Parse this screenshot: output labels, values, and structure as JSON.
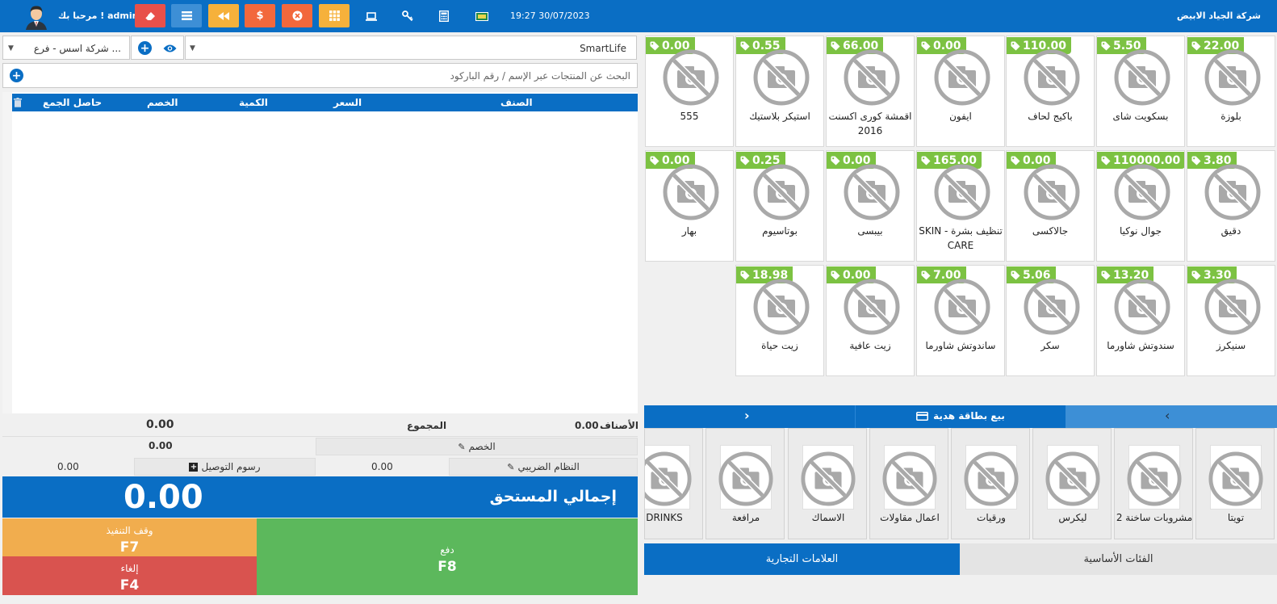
{
  "header": {
    "welcome": "مرحبا بك ! admin",
    "datetime": "19:27 30/07/2023",
    "company": "شركة الجياد الابيض",
    "colors": {
      "bar": "#0a6ec4",
      "red": "#e8504a",
      "blue": "#3d8fd6",
      "orange": "#f6b13b",
      "gift": "#1f8a4c"
    },
    "buttons": [
      {
        "name": "eraser-icon",
        "color": "#e8504a"
      },
      {
        "name": "list-icon",
        "color": "#3d8fd6"
      },
      {
        "name": "rewind-icon",
        "color": "#f6b13b"
      },
      {
        "name": "dollar-icon",
        "color": "#f2683c"
      },
      {
        "name": "close-circle-icon",
        "color": "#f2683c"
      },
      {
        "name": "grid-icon",
        "color": "#f6b13b"
      }
    ],
    "icons": [
      "laptop-icon",
      "key-icon",
      "calculator-icon",
      "money-icon"
    ]
  },
  "customer": {
    "value": "SmartLife"
  },
  "branch": {
    "value": "شركة اسس - فرع ..."
  },
  "search": {
    "placeholder": "البحث عن المنتجات عبر الإسم / رقم الباركود"
  },
  "cart": {
    "columns": {
      "item": "الصنف",
      "price": "السعر",
      "qty": "الكمية",
      "discount": "الخصم",
      "total": "حاصل الجمع"
    }
  },
  "totals": {
    "items_label": "الأصناف",
    "items_value": "0.00",
    "sum_label": "المجموع",
    "sum_value": "0.00",
    "discount_label": "الخصم",
    "discount_value": "0.00",
    "tax_label": "النظام الضريبي",
    "tax_value": "0.00",
    "delivery_label": "رسوم التوصيل",
    "delivery_value": "0.00",
    "due_label": "إجمالي المستحق",
    "due_value": "0.00"
  },
  "actions": {
    "hold_label": "وقف التنفيذ",
    "hold_key": "F7",
    "cancel_label": "إلغاء",
    "cancel_key": "F4",
    "pay_label": "دفع",
    "pay_key": "F8"
  },
  "products": [
    {
      "price": "22.00",
      "name": "بلوزة"
    },
    {
      "price": "5.50",
      "name": "بسكويت شاى"
    },
    {
      "price": "110.00",
      "name": "باكيج لحاف"
    },
    {
      "price": "0.00",
      "name": "ايفون"
    },
    {
      "price": "66.00",
      "name": "اقمشة كورى اكسنت 2016"
    },
    {
      "price": "0.55",
      "name": "استيكر بلاستيك"
    },
    {
      "price": "0.00",
      "name": "555"
    },
    {
      "price": "3.80",
      "name": "دقيق"
    },
    {
      "price": "110000.00",
      "name": "جوال نوكيا"
    },
    {
      "price": "0.00",
      "name": "جالاكسى"
    },
    {
      "price": "165.00",
      "name": "SKIN - تنظيف بشرة CARE"
    },
    {
      "price": "0.00",
      "name": "بيبسى"
    },
    {
      "price": "0.25",
      "name": "بوتاسيوم"
    },
    {
      "price": "0.00",
      "name": "بهار"
    },
    {
      "price": "3.30",
      "name": "سنيكرز"
    },
    {
      "price": "13.20",
      "name": "سندوتش شاورما"
    },
    {
      "price": "5.06",
      "name": "سكر"
    },
    {
      "price": "7.00",
      "name": "ساندوتش شاورما"
    },
    {
      "price": "0.00",
      "name": "زيت عافية"
    },
    {
      "price": "18.98",
      "name": "زيت حياة"
    }
  ],
  "giftcard": {
    "label": "بيع بطاقة هدية"
  },
  "brands": [
    "تويتا",
    "مشروبات ساخنة 2",
    "ليكرس",
    "ورقيات",
    "اعمال مقاولات",
    "الاسماك",
    "مرافعة",
    "DRINKS"
  ],
  "tabs": {
    "categories": "الفئات الأساسية",
    "brands": "العلامات التجارية"
  }
}
